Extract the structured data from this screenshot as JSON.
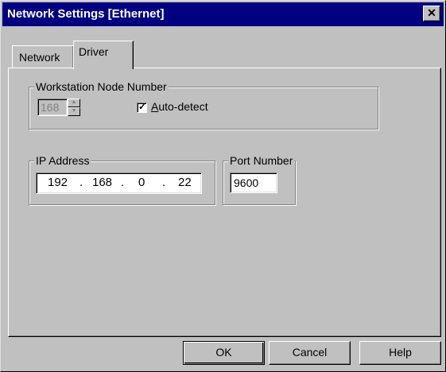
{
  "window": {
    "title": "Network Settings [Ethernet]",
    "close_glyph": "✕"
  },
  "tabs": [
    {
      "label": "Network"
    },
    {
      "label": "Driver"
    }
  ],
  "node_group": {
    "label": "Workstation Node Number",
    "node_value": "168",
    "autodetect_label_access": "A",
    "autodetect_label_rest": "uto-detect",
    "autodetect_checked": true,
    "check_glyph": "✓"
  },
  "ip_group": {
    "label": "IP Address",
    "octet1": "192",
    "octet2": "168",
    "octet3": "0",
    "octet4": "22",
    "dot": "."
  },
  "port_group": {
    "label": "Port Number",
    "value": "9600"
  },
  "buttons": {
    "ok": "OK",
    "cancel": "Cancel",
    "help": "Help"
  },
  "colors": {
    "titlebar": "#000080",
    "face": "#c0c0c0"
  }
}
